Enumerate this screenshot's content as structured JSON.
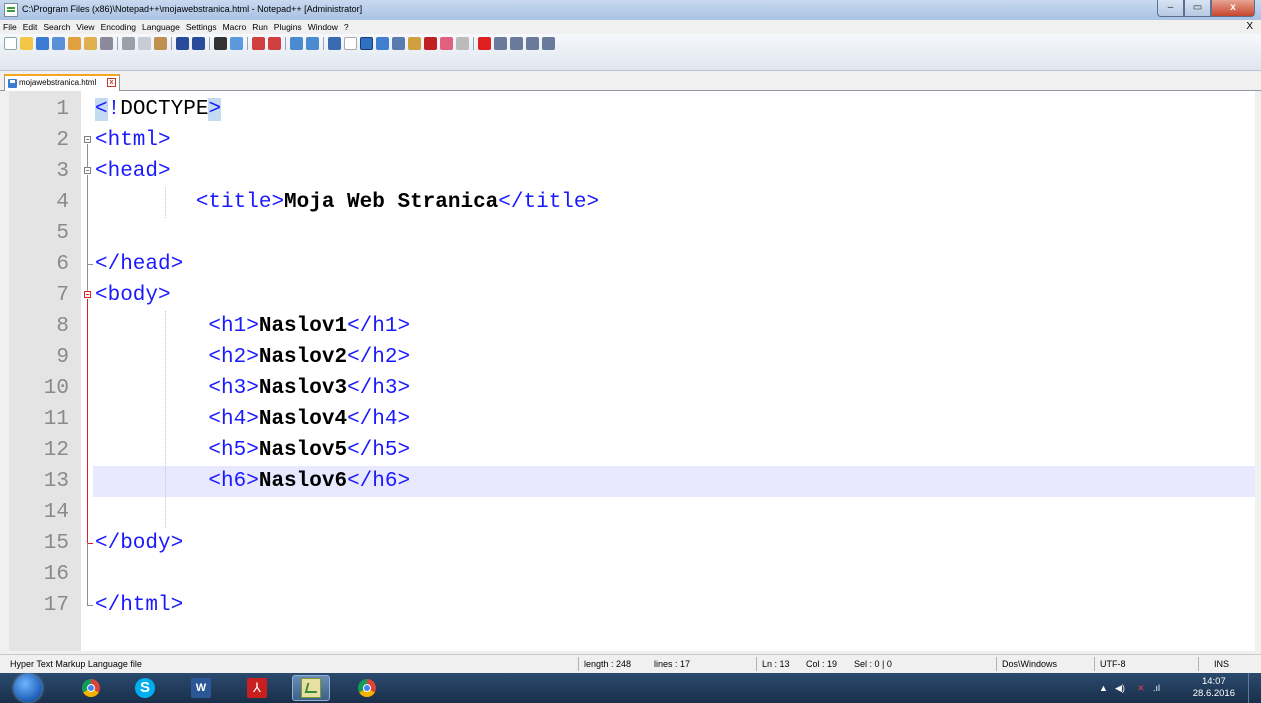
{
  "window": {
    "title": "C:\\Program Files (x86)\\Notepad++\\mojawebstranica.html - Notepad++ [Administrator]",
    "min_label": "–",
    "max_label": "▭",
    "close_label": "x"
  },
  "menu": {
    "items": [
      "File",
      "Edit",
      "Search",
      "View",
      "Encoding",
      "Language",
      "Settings",
      "Macro",
      "Run",
      "Plugins",
      "Window",
      "?"
    ],
    "close_label": "X"
  },
  "tab": {
    "label": "mojawebstranica.html",
    "close_label": "x"
  },
  "editor": {
    "current_line": 13,
    "lines": [
      {
        "n": "1",
        "code": "<!DOCTYPE>"
      },
      {
        "n": "2",
        "code": "<html>"
      },
      {
        "n": "3",
        "code": "<head>"
      },
      {
        "n": "4",
        "code": "        <title>Moja Web Stranica</title>"
      },
      {
        "n": "5",
        "code": ""
      },
      {
        "n": "6",
        "code": "</head>"
      },
      {
        "n": "7",
        "code": "<body>"
      },
      {
        "n": "8",
        "code": "         <h1>Naslov1</h1>"
      },
      {
        "n": "9",
        "code": "         <h2>Naslov2</h2>"
      },
      {
        "n": "10",
        "code": "         <h3>Naslov3</h3>"
      },
      {
        "n": "11",
        "code": "         <h4>Naslov4</h4>"
      },
      {
        "n": "12",
        "code": "         <h5>Naslov5</h5>"
      },
      {
        "n": "13",
        "code": "         <h6>Naslov6</h6>"
      },
      {
        "n": "14",
        "code": ""
      },
      {
        "n": "15",
        "code": "</body>"
      },
      {
        "n": "16",
        "code": ""
      },
      {
        "n": "17",
        "code": "</html>"
      }
    ]
  },
  "status": {
    "filetype": "Hyper Text Markup Language file",
    "length": "length : 248",
    "lines": "lines : 17",
    "ln": "Ln : 13",
    "col": "Col : 19",
    "sel": "Sel : 0 | 0",
    "eol": "Dos\\Windows",
    "encoding": "UTF-8",
    "mode": "INS"
  },
  "taskbar": {
    "apps": [
      "chrome-icon",
      "skype-icon",
      "word-icon",
      "acrobat-icon",
      "notepadpp-icon",
      "chrome-icon"
    ],
    "active_app": "notepadpp-icon",
    "time": "14:07",
    "date": "28.6.2016"
  },
  "colors": {
    "tag": "#1a1aff",
    "current_line_bg": "#e8e8ff",
    "tab_accent": "#f5a623",
    "fold_active": "#e02020"
  }
}
